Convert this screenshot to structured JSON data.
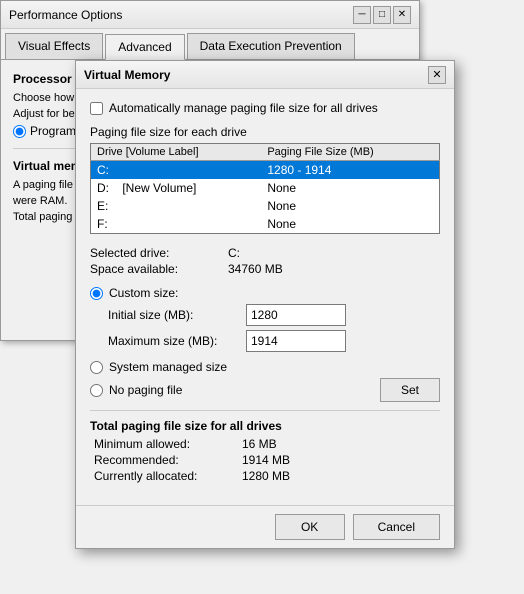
{
  "perf_window": {
    "title": "Performance Options",
    "close_btn": "✕",
    "tabs": [
      {
        "label": "Visual Effects",
        "active": false
      },
      {
        "label": "Advanced",
        "active": true
      },
      {
        "label": "Data Execution Prevention",
        "active": false
      }
    ],
    "content": {
      "processor_heading": "Processor scheduling",
      "choose_label": "Choose how to allocate processor resources.",
      "adjust_label": "Adjust for best performance of:",
      "prog_label": "Programs",
      "divider1": true,
      "virtual_heading": "Virtual memory",
      "virtual_desc1": "A paging file is an area on the hard disk that Windows uses as if it",
      "virtual_desc2": "were RAM.",
      "total_label": "Total paging file size for all drives:"
    }
  },
  "vm_dialog": {
    "title": "Virtual Memory",
    "close_btn": "✕",
    "auto_manage_label": "Automatically manage paging file size for all drives",
    "auto_manage_checked": false,
    "group_label": "Paging file size for each drive",
    "table": {
      "headers": [
        "Drive  [Volume Label]",
        "Paging File Size (MB)"
      ],
      "rows": [
        {
          "drive": "C:",
          "label": "",
          "paging": "1280 - 1914",
          "selected": true
        },
        {
          "drive": "D:",
          "label": "[New Volume]",
          "paging": "None",
          "selected": false
        },
        {
          "drive": "E:",
          "label": "",
          "paging": "None",
          "selected": false
        },
        {
          "drive": "F:",
          "label": "",
          "paging": "None",
          "selected": false
        }
      ]
    },
    "selected_drive_label": "Selected drive:",
    "selected_drive_value": "C:",
    "space_available_label": "Space available:",
    "space_available_value": "34760 MB",
    "custom_size_label": "Custom size:",
    "custom_size_checked": true,
    "initial_size_label": "Initial size (MB):",
    "initial_size_value": "1280",
    "maximum_size_label": "Maximum size (MB):",
    "maximum_size_value": "1914",
    "system_managed_label": "System managed size",
    "system_managed_checked": false,
    "no_paging_label": "No paging file",
    "no_paging_checked": false,
    "set_btn": "Set",
    "total_section_title": "Total paging file size for all drives",
    "minimum_allowed_label": "Minimum allowed:",
    "minimum_allowed_value": "16 MB",
    "recommended_label": "Recommended:",
    "recommended_value": "1914 MB",
    "currently_allocated_label": "Currently allocated:",
    "currently_allocated_value": "1280 MB",
    "ok_btn": "OK",
    "cancel_btn": "Cancel"
  }
}
